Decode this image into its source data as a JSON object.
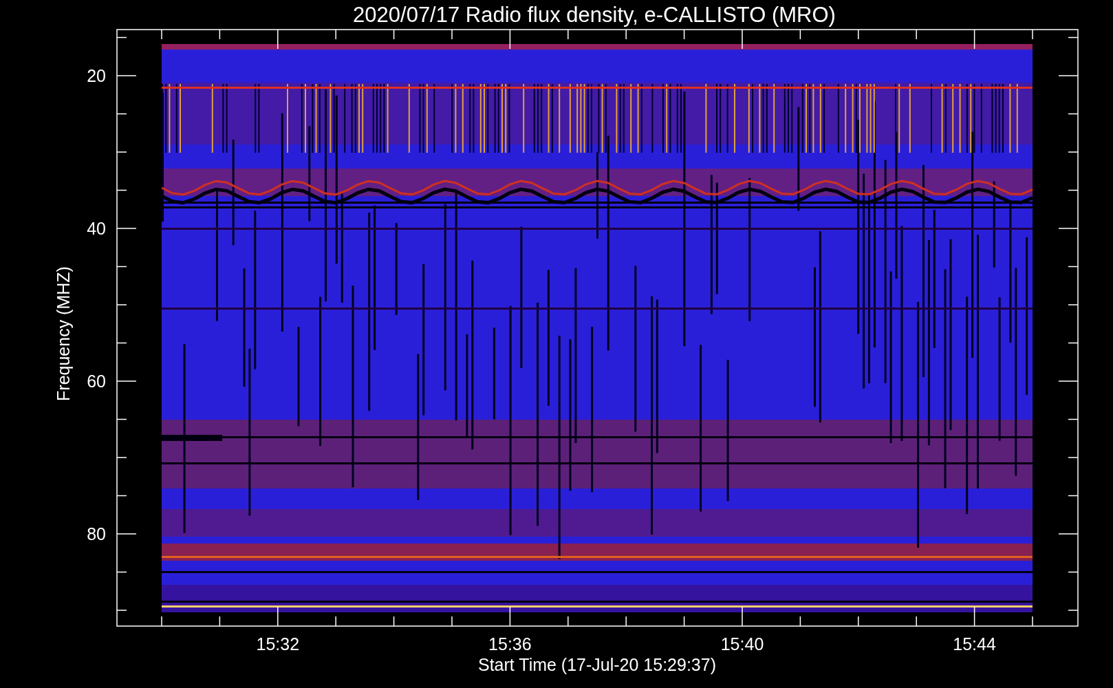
{
  "title": "2020/07/17  Radio flux density, e-CALLISTO (MRO)",
  "y_axis": {
    "label": "Frequency (MHZ)",
    "ticks": [
      "20",
      "40",
      "60",
      "80"
    ]
  },
  "x_axis": {
    "label": "Start Time (17-Jul-20 15:29:37)",
    "ticks": [
      "15:32",
      "15:36",
      "15:40",
      "15:44"
    ]
  }
}
